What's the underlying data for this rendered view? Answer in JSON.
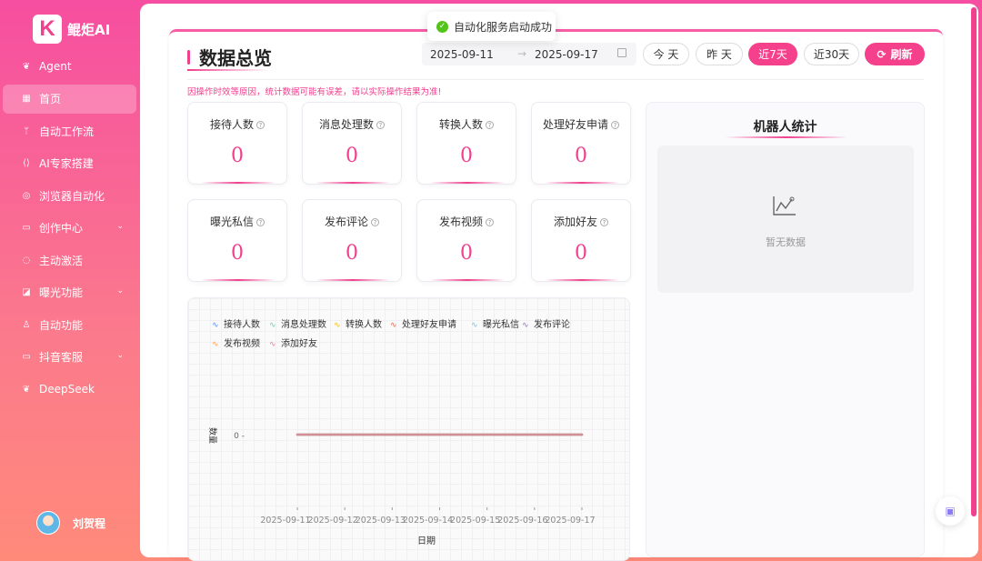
{
  "brand": {
    "logo_letter": "K",
    "name": "鲲炬AI"
  },
  "sidebar": {
    "items": [
      {
        "label": "Agent",
        "icon": "agent-icon",
        "glyph": "❦"
      },
      {
        "label": "首页",
        "icon": "grid-icon",
        "glyph": "▦",
        "active": true
      },
      {
        "label": "自动工作流",
        "icon": "branch-icon",
        "glyph": "ᛘ"
      },
      {
        "label": "AI专家搭建",
        "icon": "code-icon",
        "glyph": "⟨⟩"
      },
      {
        "label": "浏览器自动化",
        "icon": "globe-icon",
        "glyph": "◎"
      },
      {
        "label": "创作中心",
        "icon": "video-icon",
        "glyph": "▭",
        "has_children": true
      },
      {
        "label": "主动激活",
        "icon": "chat-icon",
        "glyph": "◌"
      },
      {
        "label": "曝光功能",
        "icon": "edit-icon",
        "glyph": "◪",
        "has_children": true
      },
      {
        "label": "自动功能",
        "icon": "user-icon",
        "glyph": "♙"
      },
      {
        "label": "抖音客服",
        "icon": "video-icon",
        "glyph": "▭",
        "has_children": true
      },
      {
        "label": "DeepSeek",
        "icon": "whale-icon",
        "glyph": "❦"
      }
    ],
    "user_name": "刘贺程"
  },
  "toast": {
    "text": "自动化服务启动成功",
    "color": "#52c41a"
  },
  "header": {
    "title": "数据总览",
    "date_start": "2025-09-11",
    "date_sep": "→",
    "date_end": "2025-09-17",
    "buttons": {
      "today": "今 天",
      "yesterday": "昨 天",
      "last7": "近7天",
      "last30": "近30天",
      "refresh": "刷新"
    },
    "warning": "因操作时效等原因，统计数据可能有误差，请以实际操作结果为准!"
  },
  "stats": [
    {
      "label": "接待人数",
      "value": "0"
    },
    {
      "label": "消息处理数",
      "value": "0"
    },
    {
      "label": "转换人数",
      "value": "0"
    },
    {
      "label": "处理好友申请",
      "value": "0"
    },
    {
      "label": "曝光私信",
      "value": "0"
    },
    {
      "label": "发布评论",
      "value": "0"
    },
    {
      "label": "发布视频",
      "value": "0"
    },
    {
      "label": "添加好友",
      "value": "0"
    }
  ],
  "robot": {
    "title": "机器人统计",
    "empty_text": "暂无数据"
  },
  "chart_data": {
    "type": "line",
    "x": [
      "2025-09-11",
      "2025-09-12",
      "2025-09-13",
      "2025-09-14",
      "2025-09-15",
      "2025-09-16",
      "2025-09-17"
    ],
    "series": [
      {
        "name": "接待人数",
        "values": [
          0,
          0,
          0,
          0,
          0,
          0,
          0
        ],
        "color": "#5b8ff9"
      },
      {
        "name": "消息处理数",
        "values": [
          0,
          0,
          0,
          0,
          0,
          0,
          0
        ],
        "color": "#5ad8a6"
      },
      {
        "name": "转换人数",
        "values": [
          0,
          0,
          0,
          0,
          0,
          0,
          0
        ],
        "color": "#f6bd16"
      },
      {
        "name": "处理好友申请",
        "values": [
          0,
          0,
          0,
          0,
          0,
          0,
          0
        ],
        "color": "#e8684a"
      },
      {
        "name": "曝光私信",
        "values": [
          0,
          0,
          0,
          0,
          0,
          0,
          0
        ],
        "color": "#6dc8ec"
      },
      {
        "name": "发布评论",
        "values": [
          0,
          0,
          0,
          0,
          0,
          0,
          0
        ],
        "color": "#9270ca"
      },
      {
        "name": "发布视频",
        "values": [
          0,
          0,
          0,
          0,
          0,
          0,
          0
        ],
        "color": "#ff9d4d"
      },
      {
        "name": "添加好友",
        "values": [
          0,
          0,
          0,
          0,
          0,
          0,
          0
        ],
        "color": "#f47aa0"
      }
    ],
    "xlabel": "日期",
    "ylabel": "数量",
    "y_ticks": [
      "0"
    ],
    "legend": "top"
  }
}
